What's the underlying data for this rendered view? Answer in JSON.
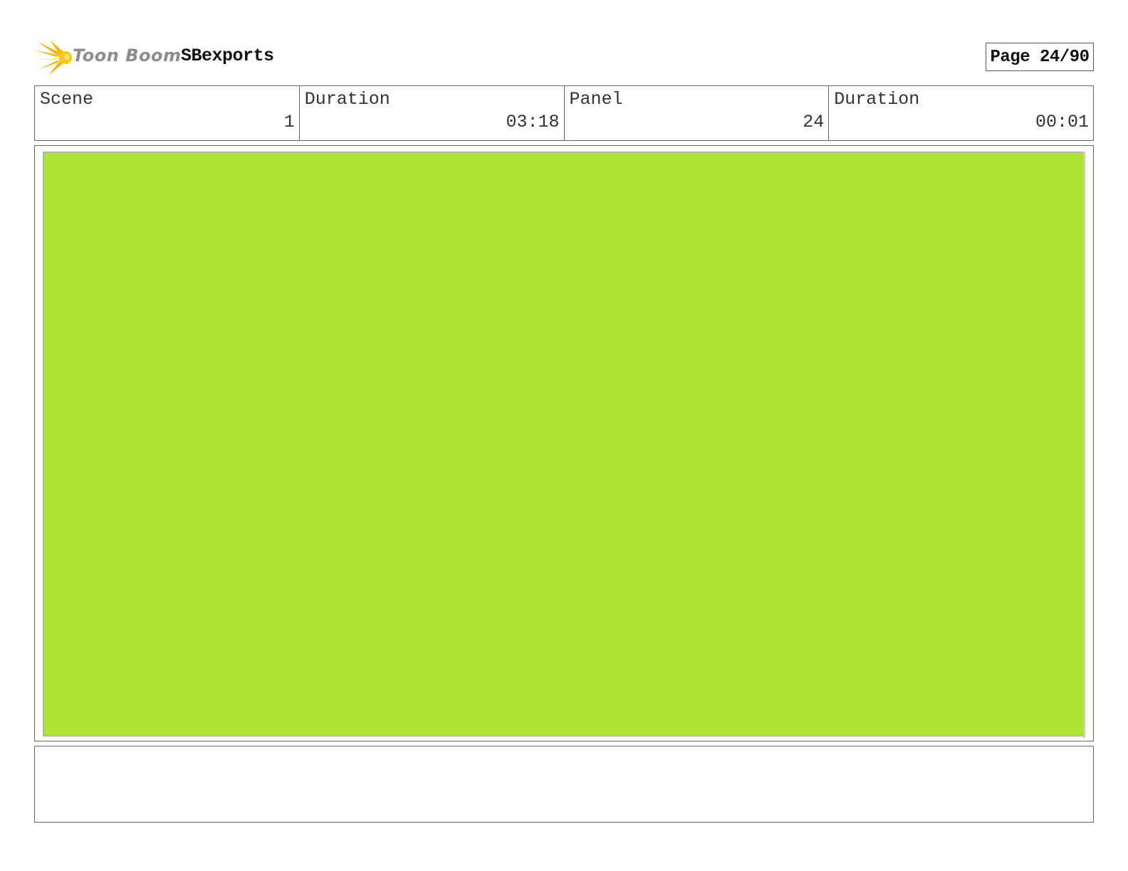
{
  "header": {
    "logo_text": "Toon Boom",
    "project_title": "SBexports",
    "page_indicator": "Page 24/90",
    "logo_color": "#f5b800"
  },
  "info": {
    "scene_label": "Scene",
    "scene_value": "1",
    "scene_duration_label": "Duration",
    "scene_duration_value": "03:18",
    "panel_label": "Panel",
    "panel_value": "24",
    "panel_duration_label": "Duration",
    "panel_duration_value": "00:01"
  },
  "panel": {
    "fill_color": "#ade333"
  },
  "notes": {
    "text": ""
  }
}
